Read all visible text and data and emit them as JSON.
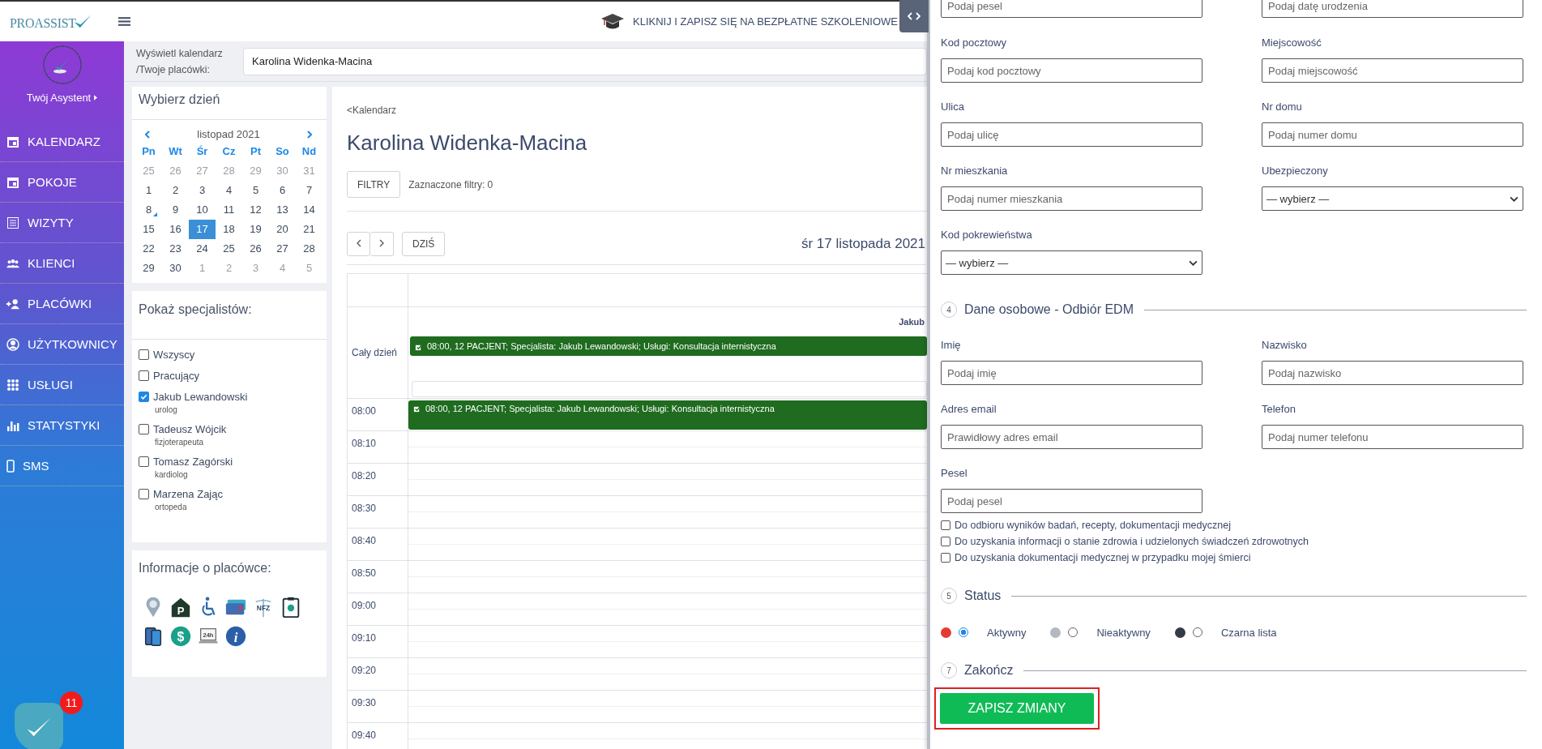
{
  "logo": {
    "text": "PROASSIST"
  },
  "banner": {
    "text": "KLIKNIJ I ZAPISZ SIĘ NA BEZPŁATNE SZKOLENIOWE"
  },
  "sidebar": {
    "assistant": "Twój Asystent",
    "items": [
      {
        "label": "KALENDARZ"
      },
      {
        "label": "POKOJE"
      },
      {
        "label": "WIZYTY"
      },
      {
        "label": "KLIENCI"
      },
      {
        "label": "PLACÓWKI"
      },
      {
        "label": "UŻYTKOWNICY"
      },
      {
        "label": "USŁUGI"
      },
      {
        "label": "STATYSTYKI"
      },
      {
        "label": "SMS"
      }
    ],
    "notifications": {
      "count": "11"
    }
  },
  "calendar_select": {
    "label": "Wyświetl kalendarz /Twoje placówki:",
    "value": "Karolina Widenka-Macina"
  },
  "day_picker": {
    "title": "Wybierz dzień",
    "month": "listopad 2021",
    "weekdays": [
      "Pn",
      "Wt",
      "Śr",
      "Cz",
      "Pt",
      "So",
      "Nd"
    ],
    "weeks": [
      [
        {
          "day": "25",
          "outside": true,
          "selected": false,
          "marked": false
        },
        {
          "day": "26",
          "outside": true,
          "selected": false,
          "marked": false
        },
        {
          "day": "27",
          "outside": true,
          "selected": false,
          "marked": false
        },
        {
          "day": "28",
          "outside": true,
          "selected": false,
          "marked": false
        },
        {
          "day": "29",
          "outside": true,
          "selected": false,
          "marked": false
        },
        {
          "day": "30",
          "outside": true,
          "selected": false,
          "marked": false
        },
        {
          "day": "31",
          "outside": true,
          "selected": false,
          "marked": false
        }
      ],
      [
        {
          "day": "1",
          "outside": false,
          "selected": false,
          "marked": false
        },
        {
          "day": "2",
          "outside": false,
          "selected": false,
          "marked": false
        },
        {
          "day": "3",
          "outside": false,
          "selected": false,
          "marked": false
        },
        {
          "day": "4",
          "outside": false,
          "selected": false,
          "marked": false
        },
        {
          "day": "5",
          "outside": false,
          "selected": false,
          "marked": false
        },
        {
          "day": "6",
          "outside": false,
          "selected": false,
          "marked": false
        },
        {
          "day": "7",
          "outside": false,
          "selected": false,
          "marked": false
        }
      ],
      [
        {
          "day": "8",
          "outside": false,
          "selected": false,
          "marked": true
        },
        {
          "day": "9",
          "outside": false,
          "selected": false,
          "marked": false
        },
        {
          "day": "10",
          "outside": false,
          "selected": false,
          "marked": false
        },
        {
          "day": "11",
          "outside": false,
          "selected": false,
          "marked": false
        },
        {
          "day": "12",
          "outside": false,
          "selected": false,
          "marked": false
        },
        {
          "day": "13",
          "outside": false,
          "selected": false,
          "marked": false
        },
        {
          "day": "14",
          "outside": false,
          "selected": false,
          "marked": false
        }
      ],
      [
        {
          "day": "15",
          "outside": false,
          "selected": false,
          "marked": false
        },
        {
          "day": "16",
          "outside": false,
          "selected": false,
          "marked": false
        },
        {
          "day": "17",
          "outside": false,
          "selected": true,
          "marked": false
        },
        {
          "day": "18",
          "outside": false,
          "selected": false,
          "marked": false
        },
        {
          "day": "19",
          "outside": false,
          "selected": false,
          "marked": false
        },
        {
          "day": "20",
          "outside": false,
          "selected": false,
          "marked": false
        },
        {
          "day": "21",
          "outside": false,
          "selected": false,
          "marked": false
        }
      ],
      [
        {
          "day": "22",
          "outside": false,
          "selected": false,
          "marked": false
        },
        {
          "day": "23",
          "outside": false,
          "selected": false,
          "marked": false
        },
        {
          "day": "24",
          "outside": false,
          "selected": false,
          "marked": false
        },
        {
          "day": "25",
          "outside": false,
          "selected": false,
          "marked": false
        },
        {
          "day": "26",
          "outside": false,
          "selected": false,
          "marked": false
        },
        {
          "day": "27",
          "outside": false,
          "selected": false,
          "marked": false
        },
        {
          "day": "28",
          "outside": false,
          "selected": false,
          "marked": false
        }
      ],
      [
        {
          "day": "29",
          "outside": false,
          "selected": false,
          "marked": false
        },
        {
          "day": "30",
          "outside": false,
          "selected": false,
          "marked": false
        },
        {
          "day": "1",
          "outside": true,
          "selected": false,
          "marked": false
        },
        {
          "day": "2",
          "outside": true,
          "selected": false,
          "marked": false
        },
        {
          "day": "3",
          "outside": true,
          "selected": false,
          "marked": false
        },
        {
          "day": "4",
          "outside": true,
          "selected": false,
          "marked": false
        },
        {
          "day": "5",
          "outside": true,
          "selected": false,
          "marked": false
        }
      ]
    ]
  },
  "specialists": {
    "title": "Pokaż specjalistów:",
    "options": [
      {
        "name": "Wszyscy",
        "checked": false
      },
      {
        "name": "Pracujący",
        "checked": false
      },
      {
        "name": "Jakub Lewandowski",
        "role": "urolog",
        "checked": true
      },
      {
        "name": "Tadeusz Wójcik",
        "role": "fizjoterapeuta",
        "checked": false
      },
      {
        "name": "Tomasz Zagórski",
        "role": "kardiolog",
        "checked": false
      },
      {
        "name": "Marzena Zając",
        "role": "ortopeda",
        "checked": false
      }
    ]
  },
  "facility_info": {
    "title": "Informacje o placówce:",
    "icon_texts": [
      "P",
      "NFZ",
      "$",
      "24h",
      "i"
    ]
  },
  "page": {
    "back_link": "<Kalendarz",
    "title": "Karolina Widenka-Macina",
    "filters_button": "FILTRY",
    "filters_count": "Zaznaczone filtry: 0",
    "today_button": "DZIŚ",
    "date_title": "śr 17 listopada 2021"
  },
  "schedule": {
    "column_header": "Jakub",
    "all_day_label": "Cały dzień",
    "all_day_events": [
      {
        "text": "08:00, 12 PACJENT; Specjalista: Jakub Lewandowski; Usługi: Konsultacja internistyczna"
      }
    ],
    "slots": [
      {
        "time": "08:00",
        "events": [
          {
            "text": "08:00, 12 PACJENT; Specjalista: Jakub Lewandowski; Usługi: Konsultacja internistyczna"
          }
        ]
      },
      {
        "time": "08:10"
      },
      {
        "time": "08:20"
      },
      {
        "time": "08:30"
      },
      {
        "time": "08:40"
      },
      {
        "time": "08:50"
      },
      {
        "time": "09:00"
      },
      {
        "time": "09:10"
      },
      {
        "time": "09:20"
      },
      {
        "time": "09:30"
      },
      {
        "time": "09:40"
      }
    ]
  },
  "form": {
    "top_fields": [
      {
        "placeholder": "Podaj pesel"
      },
      {
        "placeholder": "Podaj datę urodzenia"
      }
    ],
    "fields": [
      {
        "kind": "input",
        "label": "Kod pocztowy",
        "placeholder": "Podaj kod pocztowy"
      },
      {
        "kind": "input",
        "label": "Miejscowość",
        "placeholder": "Podaj miejscowość"
      },
      {
        "kind": "input",
        "label": "Ulica",
        "placeholder": "Podaj ulicę"
      },
      {
        "kind": "input",
        "label": "Nr domu",
        "placeholder": "Podaj numer domu"
      },
      {
        "kind": "input",
        "label": "Nr mieszkania",
        "placeholder": "Podaj numer mieszkania"
      },
      {
        "kind": "select",
        "label": "Ubezpieczony",
        "value": "— wybierz —"
      },
      {
        "kind": "select",
        "label": "Kod pokrewieństwa",
        "value": "— wybierz —"
      }
    ],
    "edm_section": {
      "number": "4",
      "title": "Dane osobowe - Odbiór EDM",
      "fields": [
        {
          "kind": "input",
          "label": "Imię",
          "placeholder": "Podaj imię"
        },
        {
          "kind": "input",
          "label": "Nazwisko",
          "placeholder": "Podaj nazwisko"
        },
        {
          "kind": "input",
          "label": "Adres email",
          "placeholder": "Prawidłowy adres email"
        },
        {
          "kind": "input",
          "label": "Telefon",
          "placeholder": "Podaj numer telefonu"
        },
        {
          "kind": "input",
          "label": "Pesel",
          "placeholder": "Podaj pesel"
        }
      ],
      "consents": [
        {
          "label": "Do odbioru wyników badań, recepty, dokumentacji medycznej",
          "checked": false
        },
        {
          "label": "Do uzyskania informacji o stanie zdrowia i udzielonych świadczeń zdrowotnych",
          "checked": false
        },
        {
          "label": "Do uzyskania dokumentacji medycznej w przypadku mojej śmierci",
          "checked": false
        }
      ]
    },
    "status_section": {
      "number": "5",
      "title": "Status",
      "options": [
        {
          "label": "Aktywny",
          "color": "#e53935",
          "selected": true
        },
        {
          "label": "Nieaktywny",
          "color": "#b4b8c0",
          "selected": false
        },
        {
          "label": "Czarna lista",
          "color": "#343b48",
          "selected": false
        }
      ]
    },
    "finish_section": {
      "number": "7",
      "title": "Zakończ",
      "button": "ZAPISZ ZMIANY",
      "highlighted": true
    }
  }
}
